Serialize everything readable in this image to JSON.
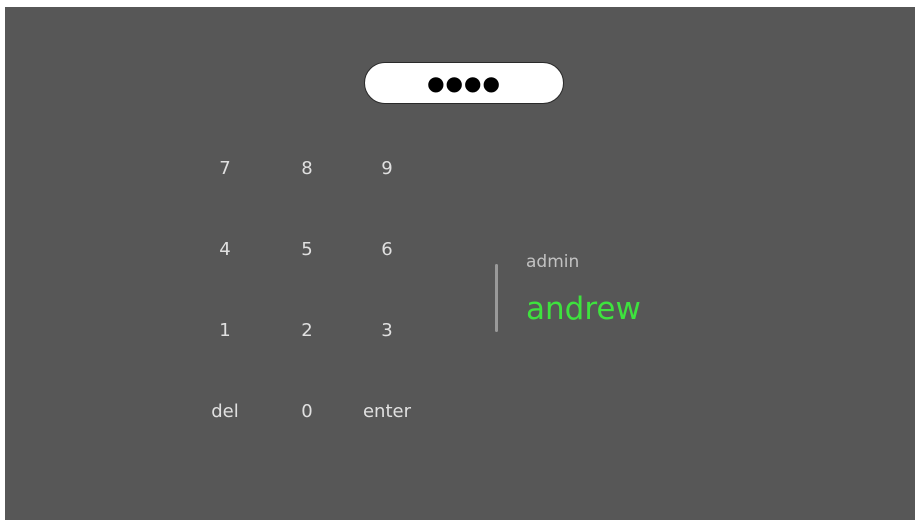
{
  "pin": {
    "masked_value": "●●●●"
  },
  "keypad": {
    "rows": [
      [
        "7",
        "8",
        "9"
      ],
      [
        "4",
        "5",
        "6"
      ],
      [
        "1",
        "2",
        "3"
      ],
      [
        "del",
        "0",
        "enter"
      ]
    ]
  },
  "users": {
    "items": [
      {
        "label": "admin",
        "selected": false
      },
      {
        "label": "andrew",
        "selected": true
      }
    ]
  },
  "colors": {
    "background": "#575757",
    "selected_user": "#3ee23e",
    "unselected_user": "#c2c2c2",
    "key_text": "#e0e0e0"
  }
}
